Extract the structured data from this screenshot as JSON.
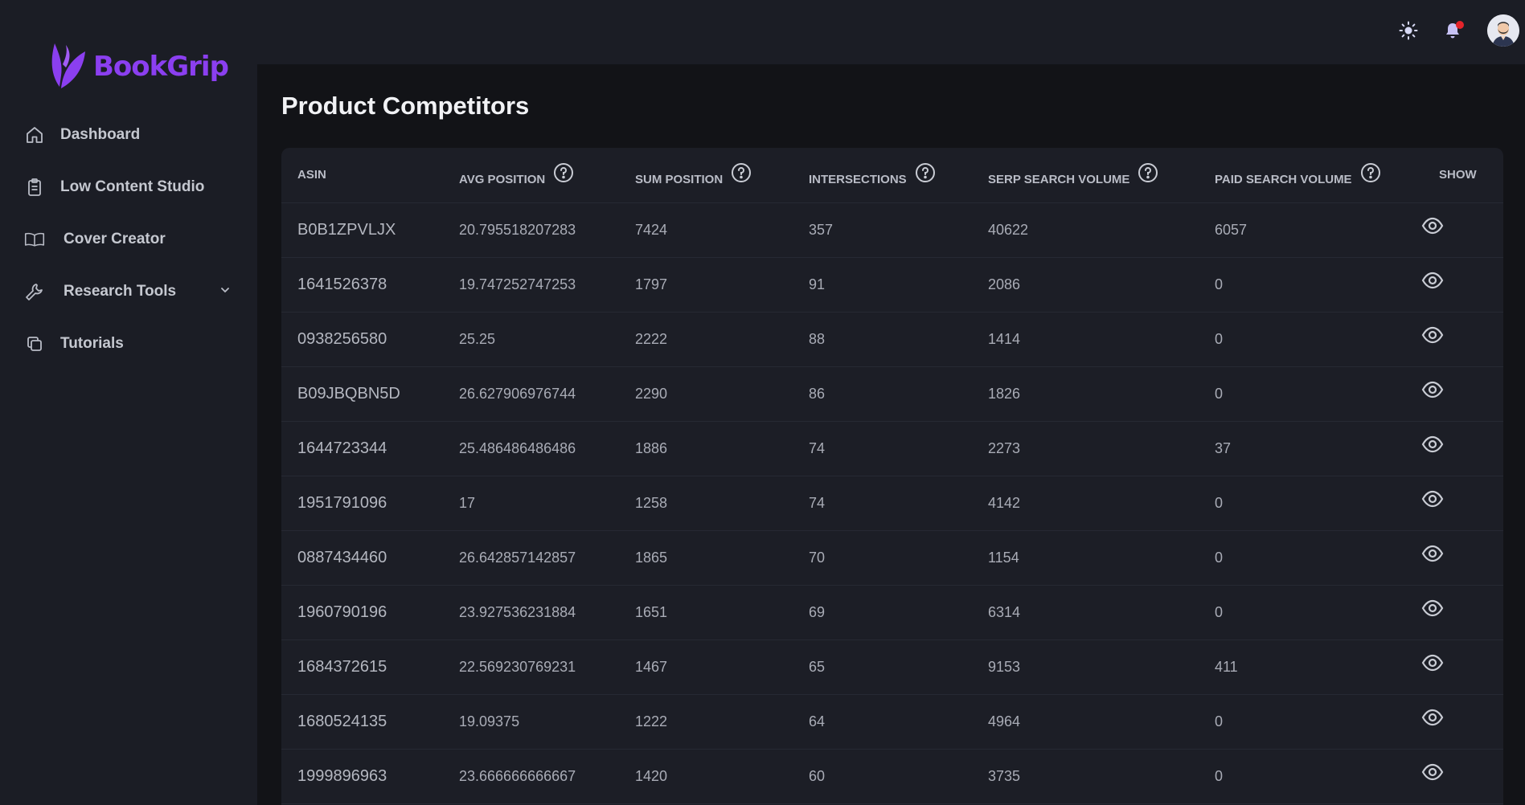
{
  "brand": {
    "name": "BookGrip",
    "color": "#8b3ff0"
  },
  "sidebar": {
    "items": [
      {
        "label": "Dashboard",
        "icon": "home-icon"
      },
      {
        "label": "Low Content Studio",
        "icon": "clipboard-icon"
      },
      {
        "label": "Cover Creator",
        "icon": "book-icon"
      },
      {
        "label": "Research Tools",
        "icon": "wrench-icon",
        "has_submenu": true
      },
      {
        "label": "Tutorials",
        "icon": "copy-icon"
      }
    ]
  },
  "topbar": {
    "theme_icon": "sun-icon",
    "notification_icon": "bell-icon",
    "notification_dot_color": "#e5242b",
    "avatar": "user-avatar"
  },
  "page": {
    "title": "Product Competitors"
  },
  "table": {
    "headers": {
      "asin": "ASIN",
      "avg_position": "AVG POSITION",
      "sum_position": "SUM POSITION",
      "intersections": "INTERSECTIONS",
      "serp_search_volume": "SERP SEARCH VOLUME",
      "paid_search_volume": "PAID SEARCH VOLUME",
      "show": "SHOW"
    },
    "rows": [
      {
        "asin": "B0B1ZPVLJX",
        "avg_position": "20.795518207283",
        "sum_position": "7424",
        "intersections": "357",
        "serp_search_volume": "40622",
        "paid_search_volume": "6057"
      },
      {
        "asin": "1641526378",
        "avg_position": "19.747252747253",
        "sum_position": "1797",
        "intersections": "91",
        "serp_search_volume": "2086",
        "paid_search_volume": "0"
      },
      {
        "asin": "0938256580",
        "avg_position": "25.25",
        "sum_position": "2222",
        "intersections": "88",
        "serp_search_volume": "1414",
        "paid_search_volume": "0"
      },
      {
        "asin": "B09JBQBN5D",
        "avg_position": "26.627906976744",
        "sum_position": "2290",
        "intersections": "86",
        "serp_search_volume": "1826",
        "paid_search_volume": "0"
      },
      {
        "asin": "1644723344",
        "avg_position": "25.486486486486",
        "sum_position": "1886",
        "intersections": "74",
        "serp_search_volume": "2273",
        "paid_search_volume": "37"
      },
      {
        "asin": "1951791096",
        "avg_position": "17",
        "sum_position": "1258",
        "intersections": "74",
        "serp_search_volume": "4142",
        "paid_search_volume": "0"
      },
      {
        "asin": "0887434460",
        "avg_position": "26.642857142857",
        "sum_position": "1865",
        "intersections": "70",
        "serp_search_volume": "1154",
        "paid_search_volume": "0"
      },
      {
        "asin": "1960790196",
        "avg_position": "23.927536231884",
        "sum_position": "1651",
        "intersections": "69",
        "serp_search_volume": "6314",
        "paid_search_volume": "0"
      },
      {
        "asin": "1684372615",
        "avg_position": "22.569230769231",
        "sum_position": "1467",
        "intersections": "65",
        "serp_search_volume": "9153",
        "paid_search_volume": "411"
      },
      {
        "asin": "1680524135",
        "avg_position": "19.09375",
        "sum_position": "1222",
        "intersections": "64",
        "serp_search_volume": "4964",
        "paid_search_volume": "0"
      },
      {
        "asin": "1999896963",
        "avg_position": "23.666666666667",
        "sum_position": "1420",
        "intersections": "60",
        "serp_search_volume": "3735",
        "paid_search_volume": "0"
      }
    ]
  }
}
